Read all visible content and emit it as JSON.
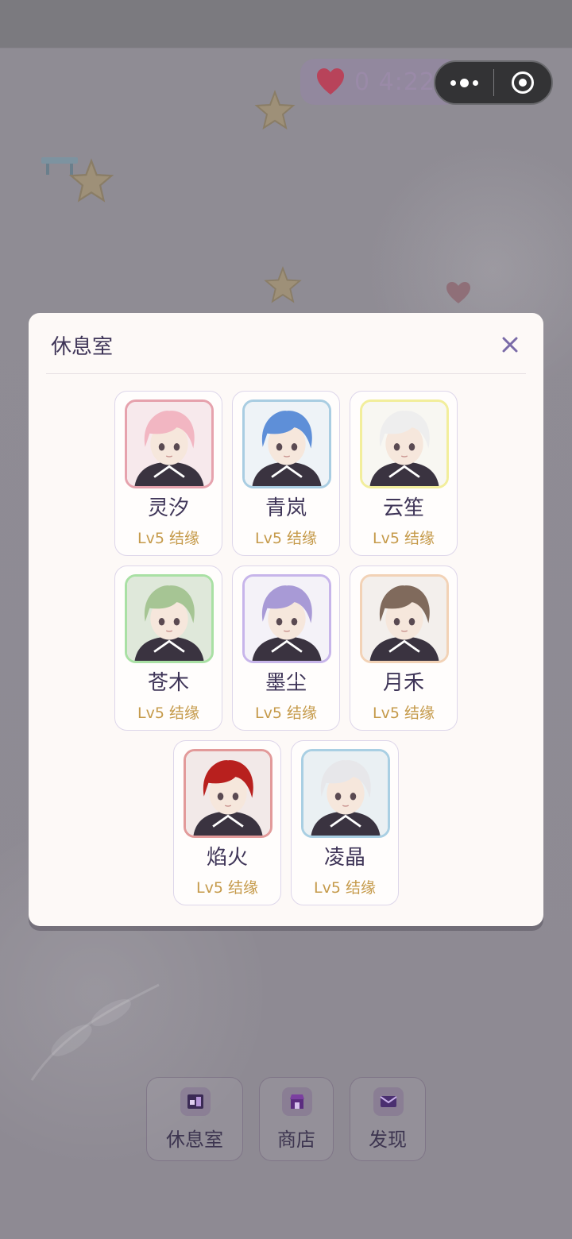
{
  "hud": {
    "currency_value": "0 4:22"
  },
  "modal": {
    "title": "休息室",
    "characters": [
      {
        "name": "灵汐",
        "level": "Lv5 结缘",
        "frame_color": "#e6a2ad",
        "hair": "#f2b6c2",
        "bg": "#f7e9ec"
      },
      {
        "name": "青岚",
        "level": "Lv5 结缘",
        "frame_color": "#a9cde2",
        "hair": "#5e8fd8",
        "bg": "#eef3f7"
      },
      {
        "name": "云笙",
        "level": "Lv5 结缘",
        "frame_color": "#f2ee9c",
        "hair": "#eeeeee",
        "bg": "#f8f7f2"
      },
      {
        "name": "苍木",
        "level": "Lv5 结缘",
        "frame_color": "#a9e0a4",
        "hair": "#a6c594",
        "bg": "#dfe8da"
      },
      {
        "name": "墨尘",
        "level": "Lv5 结缘",
        "frame_color": "#c7b5ea",
        "hair": "#a89ad6",
        "bg": "#f4f2f8"
      },
      {
        "name": "月禾",
        "level": "Lv5 结缘",
        "frame_color": "#f2d2b6",
        "hair": "#806a5c",
        "bg": "#f3efec"
      },
      {
        "name": "焰火",
        "level": "Lv5 结缘",
        "frame_color": "#e29a9a",
        "hair": "#b8201e",
        "bg": "#f2e9e8"
      },
      {
        "name": "凌晶",
        "level": "Lv5 结缘",
        "frame_color": "#a9cfe3",
        "hair": "#e7e7ea",
        "bg": "#eaf0f3"
      }
    ]
  },
  "nav": {
    "items": [
      {
        "label": "休息室",
        "icon": "lounge-icon"
      },
      {
        "label": "商店",
        "icon": "shop-icon"
      },
      {
        "label": "发现",
        "icon": "mail-icon"
      }
    ]
  }
}
